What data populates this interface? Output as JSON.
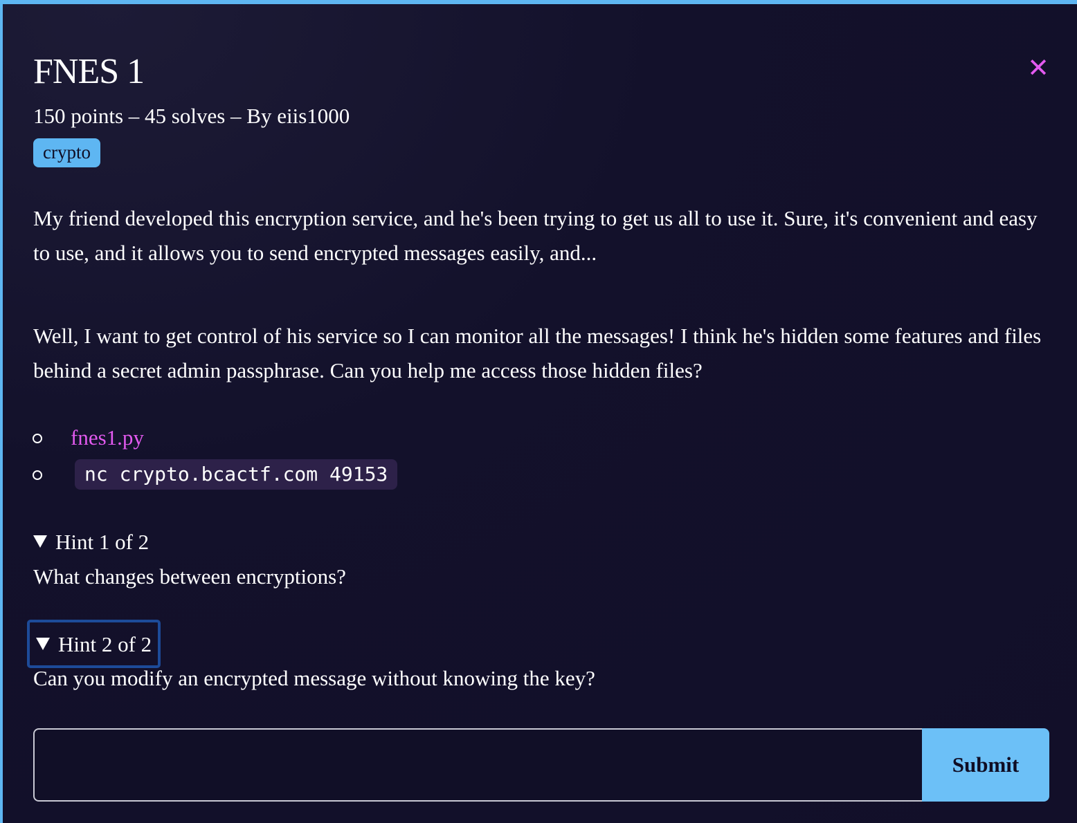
{
  "challenge": {
    "title": "FNES 1",
    "meta": "150 points – 45 solves – By eiis1000",
    "tag": "crypto",
    "close_icon": "✕",
    "description": [
      "My friend developed this encryption service, and he's been trying to get us all to use it. Sure, it's convenient and easy to use, and it allows you to send encrypted messages easily, and...",
      "Well, I want to get control of his service so I can monitor all the messages! I think he's hidden some features and files behind a secret admin passphrase. Can you help me access those hidden files?"
    ],
    "files": [
      {
        "label": "fnes1.py"
      },
      {
        "label": "nc crypto.bcactf.com 49153"
      }
    ],
    "hints": [
      {
        "summary": "Hint 1 of 2",
        "text": "What changes between encryptions?"
      },
      {
        "summary": "Hint 2 of 2",
        "text": "Can you modify an encrypted message without knowing the key?"
      }
    ]
  },
  "form": {
    "flag_value": "",
    "flag_placeholder": "",
    "submit_label": "Submit"
  },
  "colors": {
    "accent_blue": "#5eb6f2",
    "link_pink": "#e35af0",
    "background": "#13112b",
    "code_bg": "#2d2149",
    "focus_ring": "#1d4b99"
  }
}
